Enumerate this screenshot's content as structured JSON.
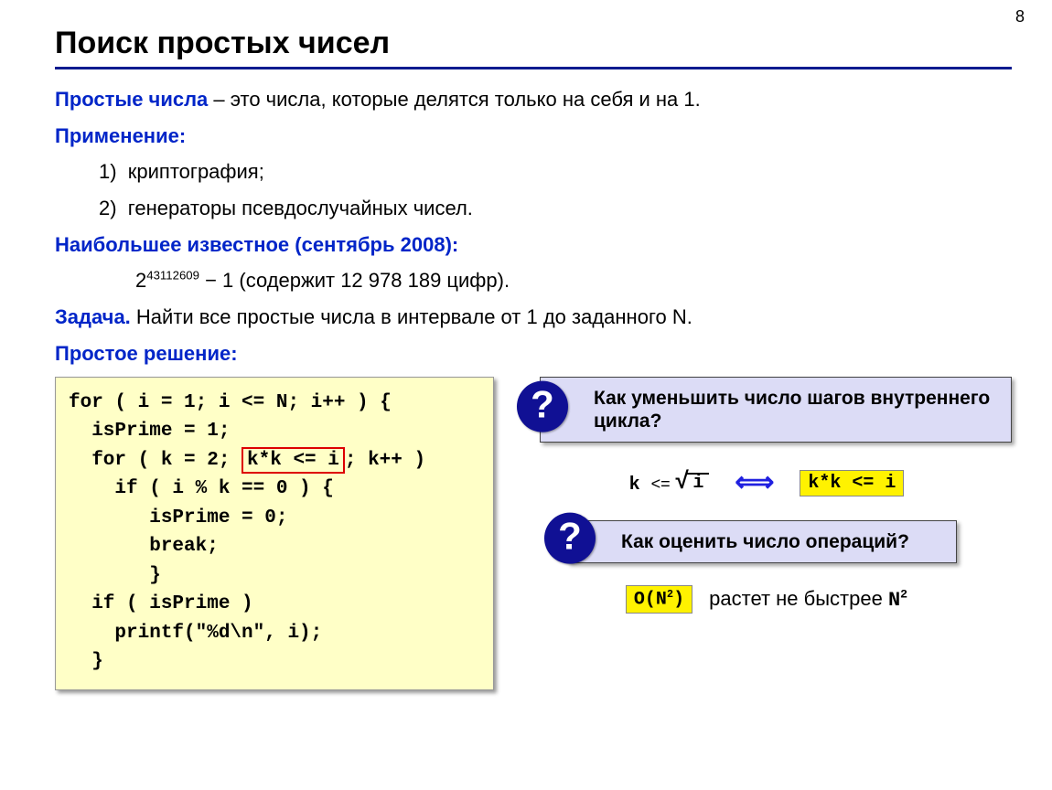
{
  "page_number": "8",
  "title": "Поиск простых чисел",
  "intro_label": "Простые числа",
  "intro_text": " – это числа, которые делятся только на себя и на 1.",
  "application_label": "Применение:",
  "application_items": [
    "1)  криптография;",
    "2)  генераторы псевдослучайных чисел."
  ],
  "largest_label": "Наибольшее известное (сентябрь 2008):",
  "largest_base": "2",
  "largest_exp": "43112609",
  "largest_rest": " − 1 (содержит 12 978 189 цифр).",
  "task_label": "Задача.",
  "task_text": " Найти все простые числа в интервале от 1 до заданного N.",
  "solution_label": "Простое решение:",
  "code": {
    "l1": "for ( i = 1; i <= N; i++ ) {",
    "l2": "  isPrime = 1;",
    "l3a": "  for ( k = 2; ",
    "l3_boxed": "k*k <= i",
    "l3b": "; k++ )",
    "l4": "    if ( i % k == 0 ) {",
    "l5": "       isPrime = 0;",
    "l6": "       break;",
    "l7": "       }",
    "l8": "  if ( isPrime )",
    "l9": "    printf(\"%d\\n\", i);",
    "l10": "  }"
  },
  "question1": "Как уменьшить число шагов внутреннего цикла?",
  "question2": "Как оценить число операций?",
  "formula": {
    "k": "k",
    "le": "<=",
    "i": "i",
    "equiv": "k*k <= i"
  },
  "complexity_label": "O(N",
  "complexity_sup": "2",
  "complexity_close": ")",
  "growth_text": "растет не быстрее ",
  "growth_N": "N",
  "growth_sup": "2"
}
